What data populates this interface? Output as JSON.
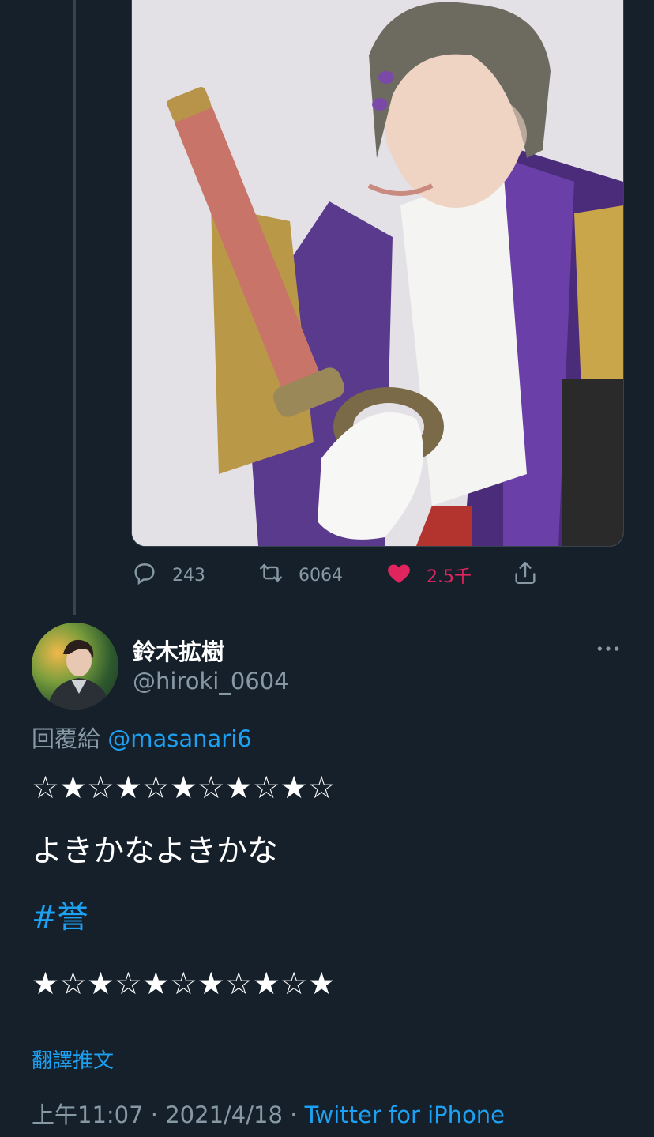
{
  "original_tweet": {
    "actions": {
      "reply_count": "243",
      "retweet_count": "6064",
      "like_count": "2.5千",
      "liked": true
    }
  },
  "tweet": {
    "author": {
      "display_name": "鈴木拡樹",
      "handle": "@hiroki_0604"
    },
    "reply_label": "回覆給",
    "reply_to": "@masanari6",
    "lines": [
      "☆★☆★☆★☆★☆★☆",
      "よきかなよきかな",
      "#誉",
      "★☆★☆★☆★☆★☆★"
    ],
    "translate_label": "翻譯推文",
    "time": "上午11:07",
    "separator": "·",
    "date": "2021/4/18",
    "source": "Twitter for iPhone"
  },
  "colors": {
    "background": "#15202b",
    "text": "#ffffff",
    "secondary": "#8899a6",
    "link": "#1da1f2",
    "like": "#e0245e"
  },
  "icons": [
    "reply-icon",
    "retweet-icon",
    "heart-icon",
    "share-icon",
    "more-icon"
  ]
}
